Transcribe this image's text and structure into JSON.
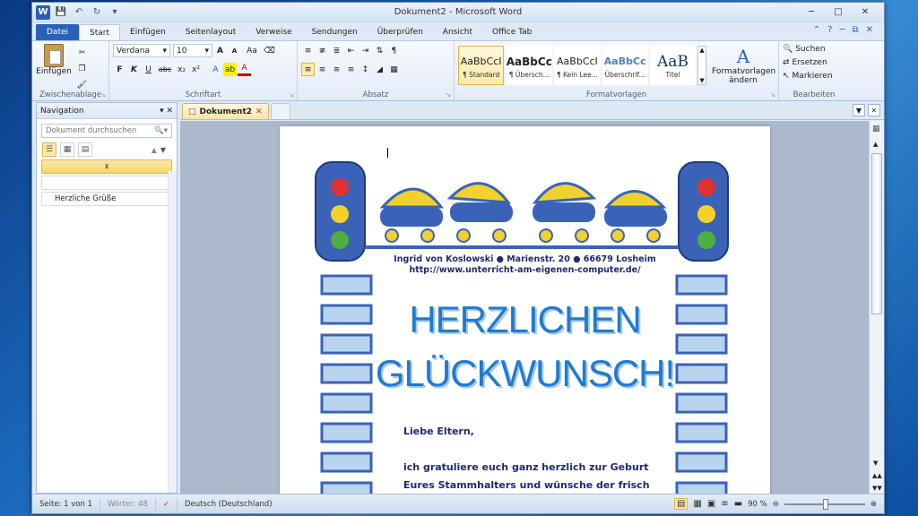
{
  "window": {
    "title": "Dokument2 - Microsoft Word",
    "app_icon": "W"
  },
  "qat": {
    "icons": [
      "save-icon",
      "undo-icon",
      "redo-icon",
      "customize-icon"
    ]
  },
  "tabs": [
    "Datei",
    "Start",
    "Einfügen",
    "Seitenlayout",
    "Verweise",
    "Sendungen",
    "Überprüfen",
    "Ansicht",
    "Office Tab"
  ],
  "ribbon": {
    "clipboard": {
      "label": "Zwischenablage",
      "paste": "Einfügen"
    },
    "font": {
      "label": "Schriftart",
      "family": "Verdana",
      "size": "10",
      "bold": "F",
      "italic": "K",
      "underline": "U",
      "strike": "abc",
      "sub": "x₂",
      "sup": "x²",
      "grow": "A",
      "shrink": "A",
      "aa": "Aa"
    },
    "paragraph": {
      "label": "Absatz"
    },
    "styles": {
      "label": "Formatvorlagen",
      "items": [
        {
          "preview": "AaBbCcI",
          "name": "¶ Standard"
        },
        {
          "preview": "AaBbCc",
          "name": "¶ Übersch..."
        },
        {
          "preview": "AaBbCcI",
          "name": "¶ Kein Lee..."
        },
        {
          "preview": "AaBbCc",
          "name": "Überschrif..."
        },
        {
          "preview": "AaB",
          "name": "Titel"
        }
      ],
      "change": "Formatvorlagen ändern"
    },
    "editing": {
      "label": "Bearbeiten",
      "find": "Suchen",
      "replace": "Ersetzen",
      "select": "Markieren"
    }
  },
  "nav": {
    "title": "Navigation",
    "search_placeholder": "Dokument durchsuchen",
    "headings": [
      "",
      "",
      "Herzliche Grüße"
    ]
  },
  "doctab": {
    "name": "Dokument2"
  },
  "document": {
    "address": "Ingrid von Koslowski ● Marienstr. 20 ●  66679 Losheim",
    "url": "http://www.unterricht-am-eigenen-computer.de/",
    "title1": "HERZLICHEN",
    "title2": "GLÜCKWUNSCH!",
    "salutation": "Liebe Eltern,",
    "line1": "ich gratuliere euch ganz herzlich zur Geburt",
    "line2": "Eures Stammhalters  und wünsche der frisch"
  },
  "status": {
    "page": "Seite: 1 von 1",
    "words": "Wörter: 48",
    "language": "Deutsch (Deutschland)",
    "zoom": "90 %"
  },
  "colors": {
    "file_tab": "#2a62b8",
    "title_blue": "#1f7bd1",
    "frame_blue": "#3a63b8",
    "text_navy": "#1e2a6e"
  }
}
